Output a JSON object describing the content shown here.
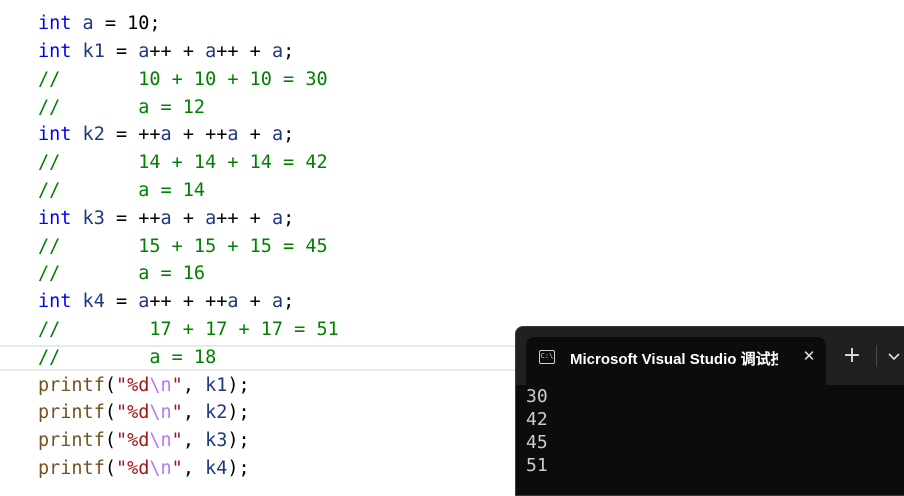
{
  "editor": {
    "lines": [
      {
        "t1": "int",
        "t2": " a",
        "t3": " = 10;"
      },
      {
        "t1": "int",
        "t2": " k1",
        "t3": " = ",
        "t4": "a",
        "t5": "++ + ",
        "t6": "a",
        "t7": "++ + ",
        "t8": "a",
        "t9": ";"
      },
      {
        "c1": "//",
        "c2": "       10 + 10 + 10 = 30"
      },
      {
        "c1": "//",
        "c2": "       a = 12"
      },
      {
        "t1": "int",
        "t2": " k2",
        "t3": " = ++",
        "t4": "a",
        "t5": " + ++",
        "t6": "a",
        "t7": " + ",
        "t8": "a",
        "t9": ";"
      },
      {
        "c1": "//",
        "c2": "       14 + 14 + 14 = 42"
      },
      {
        "c1": "//",
        "c2": "       a = 14"
      },
      {
        "t1": "int",
        "t2": " k3",
        "t3": " = ++",
        "t4": "a",
        "t5": " + ",
        "t6": "a",
        "t7": "++ + ",
        "t8": "a",
        "t9": ";"
      },
      {
        "c1": "//",
        "c2": "       15 + 15 + 15 = 45"
      },
      {
        "c1": "//",
        "c2": "       a = 16"
      },
      {
        "t1": "int",
        "t2": " k4",
        "t3": " = ",
        "t4": "a",
        "t5": "++ + ++",
        "t6": "a",
        "t7": " + ",
        "t8": "a",
        "t9": ";"
      },
      {
        "c1": "//",
        "c2": "        17 + 17 + 17 = 51"
      },
      {
        "c1": "//",
        "c2": "        a = 18"
      },
      {
        "fn": "printf",
        "p1": "(",
        "s1": "\"%d",
        "e": "\\n",
        "s2": "\"",
        "p2": ", ",
        "v": "k1",
        "p3": ");"
      },
      {
        "fn": "printf",
        "p1": "(",
        "s1": "\"%d",
        "e": "\\n",
        "s2": "\"",
        "p2": ", ",
        "v": "k2",
        "p3": ");"
      },
      {
        "fn": "printf",
        "p1": "(",
        "s1": "\"%d",
        "e": "\\n",
        "s2": "\"",
        "p2": ", ",
        "v": "k3",
        "p3": ");"
      },
      {
        "fn": "printf",
        "p1": "(",
        "s1": "\"%d",
        "e": "\\n",
        "s2": "\"",
        "p2": ", ",
        "v": "k4",
        "p3": ");"
      }
    ]
  },
  "console": {
    "tab_title": "Microsoft Visual Studio 调试控",
    "icon_glyph": "C:\\",
    "close_glyph": "✕",
    "plus_glyph": "+",
    "output": [
      "30",
      "42",
      "45",
      "51"
    ]
  },
  "colors": {
    "keyword": "#0000ff",
    "variable": "#1f377f",
    "comment": "#008000",
    "function": "#74531f",
    "string": "#a31515",
    "escape": "#b776fb",
    "console_bg": "#0c0c0c",
    "console_text": "#cccccc"
  }
}
